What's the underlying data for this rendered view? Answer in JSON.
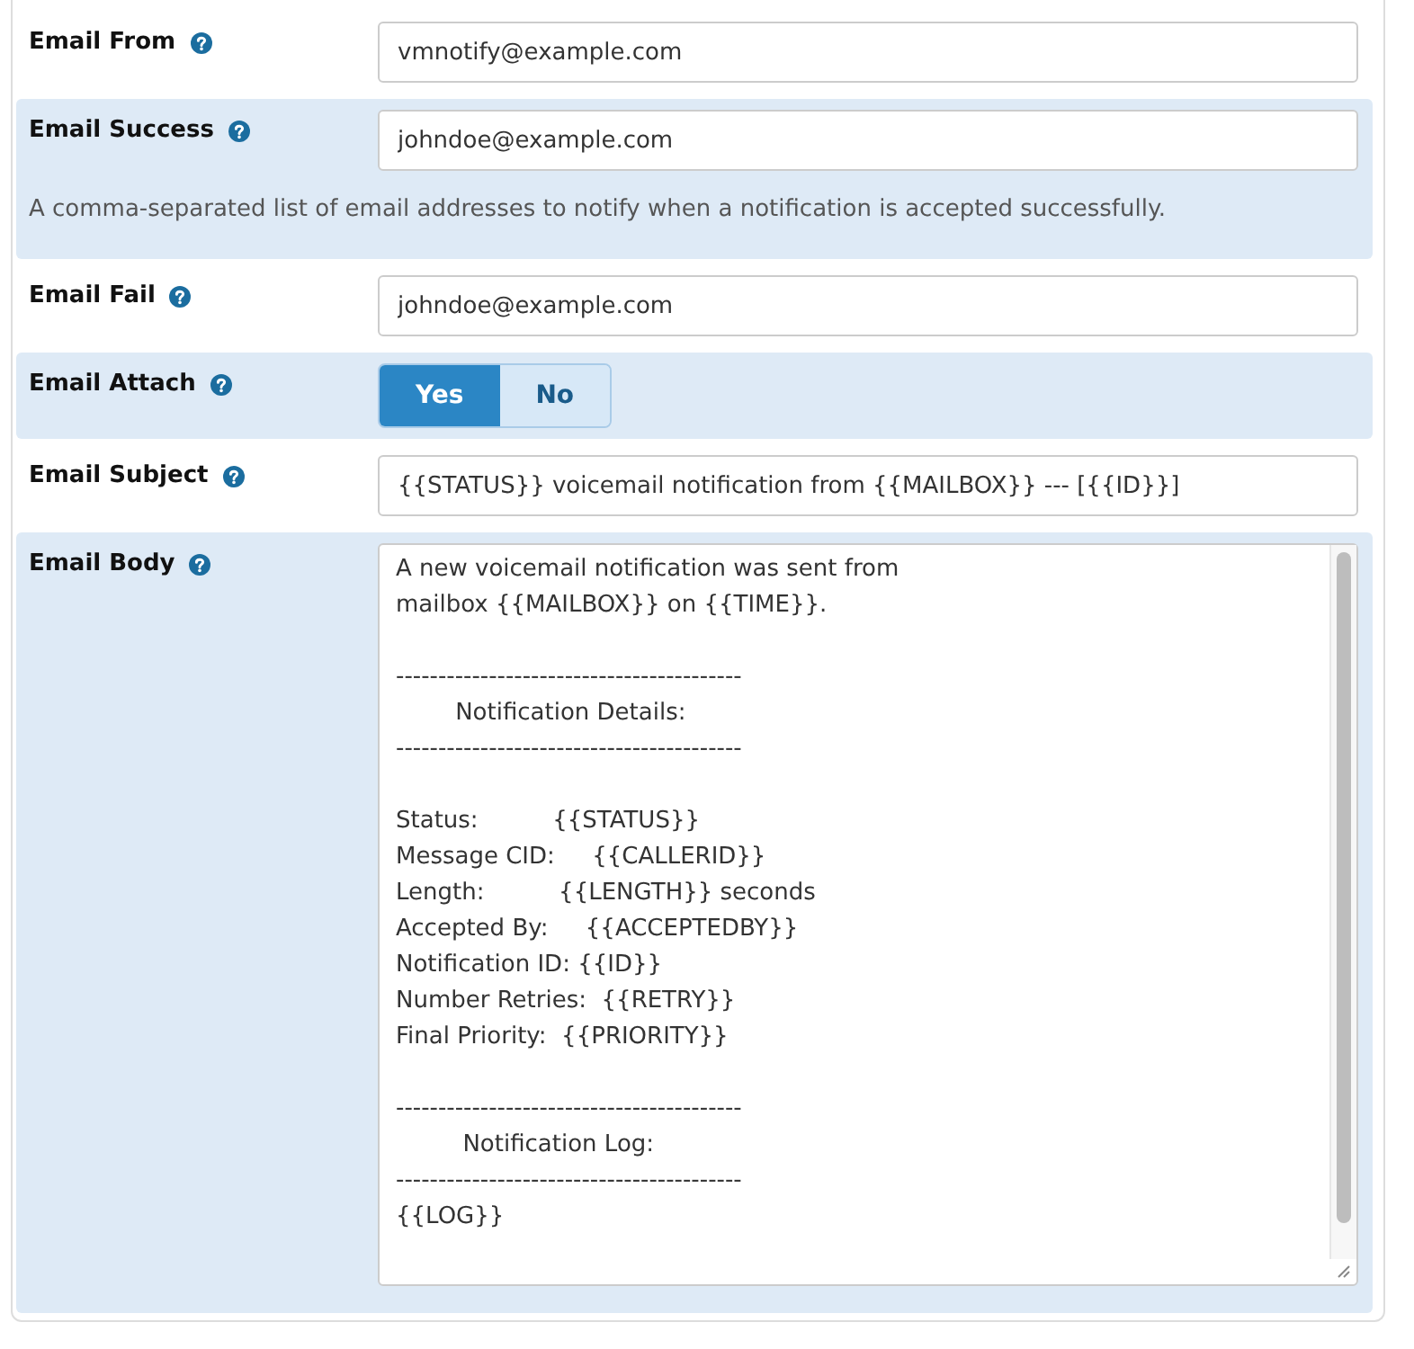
{
  "fields": [
    {
      "kind": "text",
      "label": "Email From",
      "value": "vmnotify@example.com"
    },
    {
      "kind": "text",
      "label": "Email Success",
      "value": "johndoe@example.com",
      "help_text": "A comma-separated list of email addresses to notify when a notification is accepted successfully."
    },
    {
      "kind": "text",
      "label": "Email Fail",
      "value": "johndoe@example.com"
    },
    {
      "kind": "toggle",
      "label": "Email Attach",
      "options": [
        {
          "label": "Yes",
          "selected": true
        },
        {
          "label": "No",
          "selected": false
        }
      ]
    },
    {
      "kind": "text",
      "label": "Email Subject",
      "value": "{{STATUS}} voicemail notification from {{MAILBOX}} --- [{{ID}}]"
    },
    {
      "kind": "textarea",
      "label": "Email Body",
      "value": "A new voicemail notification was sent from\nmailbox {{MAILBOX}} on {{TIME}}.\n\n-----------------------------------------\n        Notification Details:\n-----------------------------------------\n\nStatus:          {{STATUS}}\nMessage CID:     {{CALLERID}}\nLength:          {{LENGTH}} seconds\nAccepted By:     {{ACCEPTEDBY}}\nNotification ID: {{ID}}\nNumber Retries:  {{RETRY}}\nFinal Priority:  {{PRIORITY}}\n\n-----------------------------------------\n         Notification Log:\n-----------------------------------------\n{{LOG}}"
    }
  ]
}
